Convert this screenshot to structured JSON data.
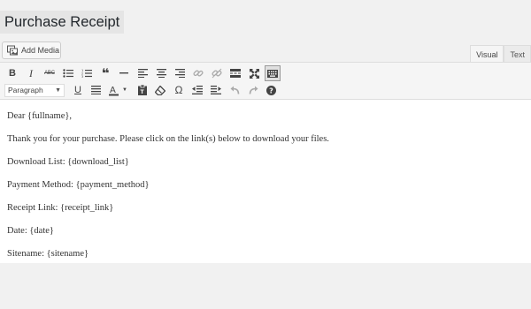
{
  "title": "Purchase Receipt",
  "add_media_label": "Add Media",
  "tabs": [
    {
      "label": "Visual",
      "active": true
    },
    {
      "label": "Text",
      "active": false
    }
  ],
  "format_select": {
    "value": "Paragraph"
  },
  "toolbar": {
    "bold": "B",
    "italic": "I",
    "strikethrough": "ABC",
    "blockquote": "❝",
    "omega": "Ω"
  },
  "content": {
    "lines": [
      "Dear {fullname},",
      "Thank you for your purchase. Please click on the link(s) below to download your files.",
      "Download List: {download_list}",
      "Payment Method: {payment_method}",
      "Receipt Link: {receipt_link}",
      "Date: {date}",
      "Sitename: {sitename}"
    ]
  }
}
